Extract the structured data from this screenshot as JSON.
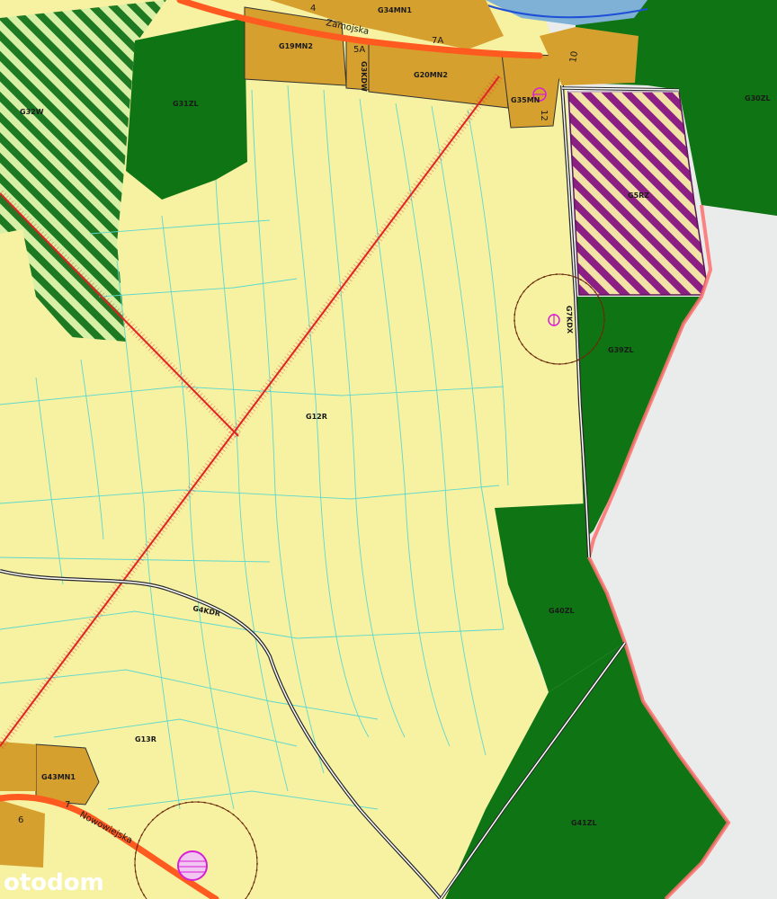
{
  "colors": {
    "agricultural": "#f6f2a2",
    "forest": "#0f7413",
    "residential": "#d6a02f",
    "road_main": "#ff5a1f",
    "parcel_line": "#5fd7cc",
    "powerline": "#e02424",
    "boundary": "#ff6f6f",
    "outside": "#e9ecea"
  },
  "zones": {
    "g12r": "G12R",
    "g13r": "G13R",
    "g19mn2": "G19MN2",
    "g20mn2": "G20MN2",
    "g34mn1": "G34MN1",
    "g35mn": "G35MN",
    "g43mn1": "G43MN1",
    "g5rz": "G5RZ",
    "g32w": "G32W",
    "g31zl": "G31ZL",
    "g30zl": "G30ZL",
    "g39zl": "G39ZL",
    "g40zl": "G40ZL",
    "g41zl": "G41ZL",
    "g4kdr": "G4KDR",
    "g7kdx": "G7KDX",
    "g3kdw": "G3KDW"
  },
  "roads": {
    "zamojska": "Zamojska",
    "nowowiejska": "Nowowiejska"
  },
  "road_numbers": [
    "4",
    "5A",
    "7A",
    "10",
    "12",
    "6",
    "7"
  ],
  "icons": [
    "antenna-icon"
  ],
  "watermark": "otodom"
}
